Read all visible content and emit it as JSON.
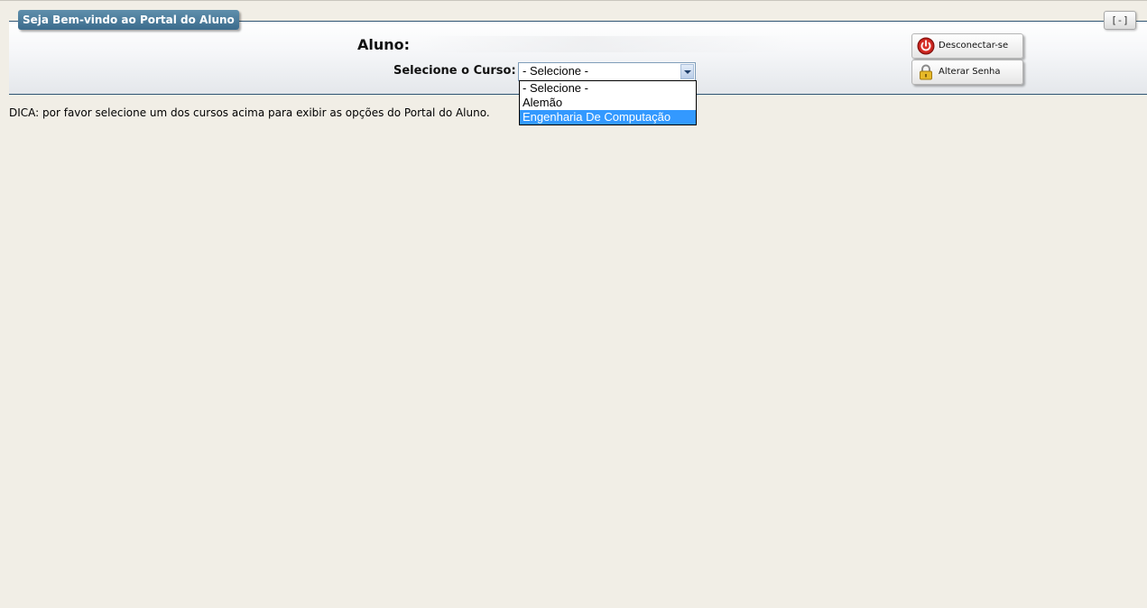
{
  "header": {
    "title": "Seja Bem-vindo ao Portal do Aluno",
    "collapse_label": "[-]"
  },
  "student": {
    "label": "Aluno:",
    "value": ""
  },
  "course": {
    "label": "Selecione o Curso:",
    "selected": "- Selecione -",
    "options": [
      "- Selecione -",
      "Alemão",
      "Engenharia De Computação"
    ],
    "highlighted_option": "Engenharia De Computação"
  },
  "buttons": {
    "disconnect": "Desconectar-se",
    "change_password": "Alterar Senha"
  },
  "tip": "DICA: por favor selecione um dos cursos acima para exibir as opções do Portal do Aluno.",
  "colors": {
    "header_bg": "#3b6b8c",
    "highlight": "#3399ff",
    "page_bg": "#f1eee6"
  }
}
